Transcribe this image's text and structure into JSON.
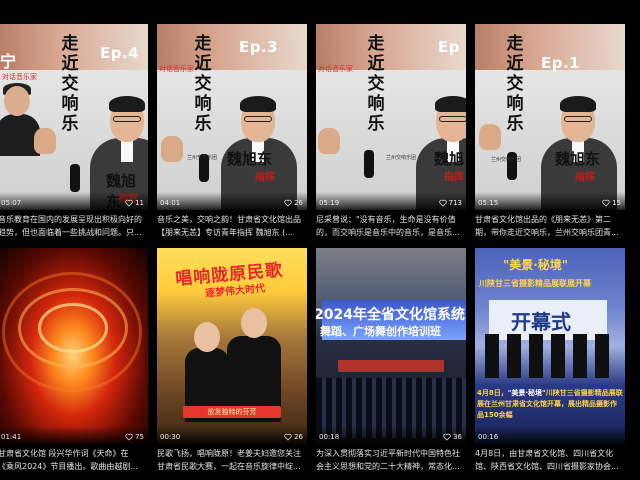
{
  "cards": [
    {
      "duration": "05:07",
      "likes": "11",
      "caption_line1": "音乐教育在国内的发展呈现出积极向好的",
      "caption_line2": "趋势，但也面临着一些挑战和问题。只...",
      "thumb": {
        "title": "走近交响乐",
        "episode": "Ep.4",
        "host": "对话音乐家",
        "left_char": "宁",
        "name": "魏旭东",
        "role": "指挥"
      }
    },
    {
      "duration": "04:01",
      "likes": "26",
      "caption_line1": "音乐之美，交响之韵！甘肃省文化馆出品",
      "caption_line2": "【朋来无恙】专访青年指挥 魏旭东 (...",
      "thumb": {
        "title": "走近交响乐",
        "episode": "Ep.3",
        "host": "对话音乐家",
        "org": "兰州交响乐团",
        "name": "魏旭东",
        "role": "指挥"
      }
    },
    {
      "duration": "05:19",
      "likes": "713",
      "caption_line1": "尼采曾说：\"没有音乐，生命是没有价值",
      "caption_line2": "的，而交响乐是音乐中的音乐，是音乐...",
      "thumb": {
        "title": "走近交响乐",
        "episode": "Ep",
        "host": "对话音乐家",
        "org": "兰州交响乐团",
        "name": "魏旭",
        "role": "指挥"
      }
    },
    {
      "duration": "05:15",
      "likes": "15",
      "caption_line1": "甘肃省文化馆出品的《朋来无恙》第二",
      "caption_line2": "期，带你走近交响乐，兰州交响乐团青...",
      "thumb": {
        "title": "走近交响乐",
        "episode": "Ep.1",
        "org": "兰州交响乐团",
        "name": "魏旭东",
        "role": "指挥"
      }
    },
    {
      "duration": "01:41",
      "likes": "75",
      "caption_line1": "甘肃省文化馆 段兴华作词《天命》在",
      "caption_line2": "《乘风2024》节目播出。歌曲由越剧..."
    },
    {
      "duration": "00:30",
      "likes": "26",
      "caption_line1": "民歌飞扬，唱响陇原！老姜夫妇邀您关注",
      "caption_line2": "甘肃省民歌大赛，一起在音乐旋律中绽...",
      "thumb": {
        "title1": "唱响陇原民歌",
        "title2": "逐梦伟大时代",
        "banner": "放发独特的芬芳"
      }
    },
    {
      "duration": "00:18",
      "likes": "36",
      "caption_line1": "为深入贯彻落实习近平新时代中国特色社",
      "caption_line2": "会主义思想和党的二十大精神，常态化...",
      "thumb": {
        "line1": "2024年全省文化馆系统",
        "line2": "舞蹈、广场舞创作培训班"
      }
    },
    {
      "duration": "00:16",
      "likes": "",
      "caption_line1": "4月8日，由甘肃省文化馆、四川省文化",
      "caption_line2": "馆、陕西省文化馆、四川省摄影家协会...",
      "thumb": {
        "top": "\"美景·秘境\"",
        "sub": "川陕甘三省摄影精品展联展开幕",
        "board": "开幕式",
        "news_date": "4月8日，",
        "news_quote": "\"美景·秘境\"",
        "news_rest": "川陕甘三省摄影精品展联展在兰州甘肃省文化馆开幕，展出精品摄影作品150余幅"
      }
    }
  ]
}
